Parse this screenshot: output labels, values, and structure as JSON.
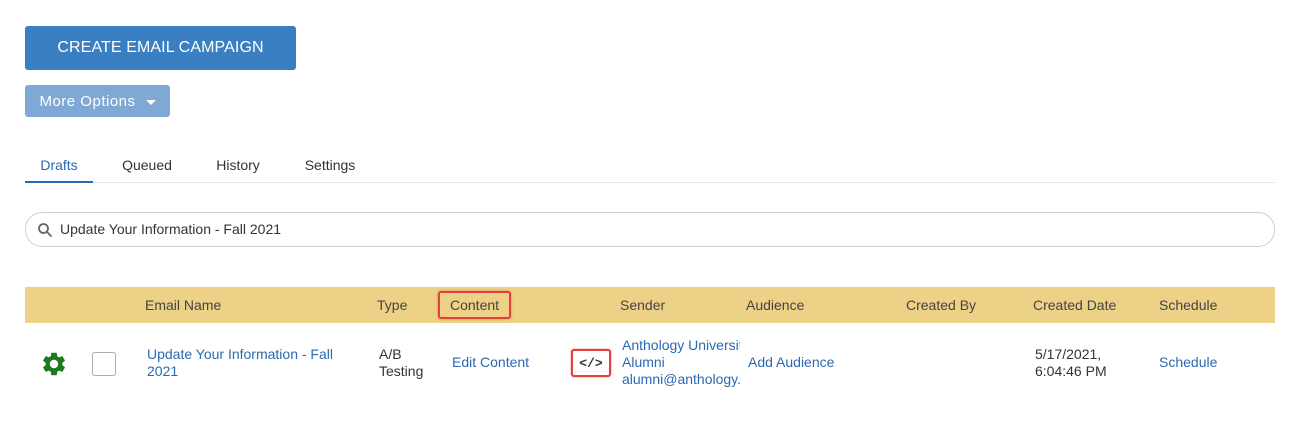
{
  "actions": {
    "create_label": "CREATE EMAIL CAMPAIGN",
    "more_label": "More Options"
  },
  "tabs": [
    {
      "label": "Drafts",
      "active": true
    },
    {
      "label": "Queued",
      "active": false
    },
    {
      "label": "History",
      "active": false
    },
    {
      "label": "Settings",
      "active": false
    }
  ],
  "search": {
    "value": "Update Your Information - Fall 2021",
    "icon": "search-icon"
  },
  "table": {
    "headers": {
      "email_name": "Email Name",
      "type": "Type",
      "content": "Content",
      "sender": "Sender",
      "audience": "Audience",
      "created_by": "Created By",
      "created_date": "Created Date",
      "schedule": "Schedule"
    },
    "rows": [
      {
        "email_name_line1": "Update Your Information - Fall",
        "email_name_line2": "2021",
        "type_line1": "A/B",
        "type_line2": "Testing",
        "content_link": "Edit Content",
        "code_icon": "</>",
        "sender_line1": "Anthology University",
        "sender_line2": "Alumni",
        "sender_line3": "alumni@anthology.com",
        "audience_link": "Add Audience",
        "created_by": "",
        "created_date_line1": "5/17/2021,",
        "created_date_line2": "6:04:46 PM",
        "schedule_link": "Schedule"
      }
    ]
  },
  "colors": {
    "primary": "#3a7fc2",
    "secondary": "#7fa9d4",
    "header_bg": "#ecd187",
    "link": "#2a6ab0",
    "highlight": "#e0413c",
    "gear": "#1f7a1f"
  }
}
